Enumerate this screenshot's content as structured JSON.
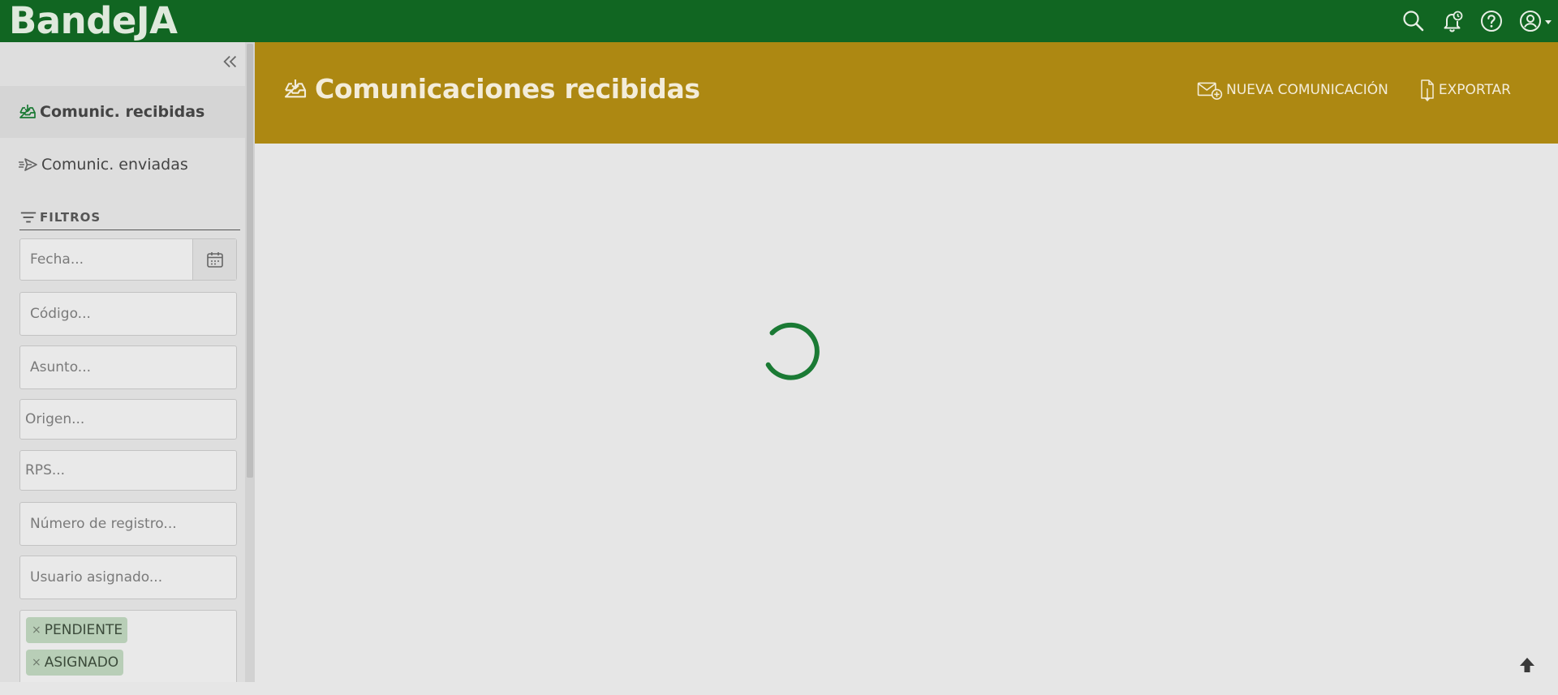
{
  "app": {
    "logo": "BandeJA"
  },
  "topbar": {
    "icons": [
      "search-icon",
      "bell-clock-icon",
      "help-icon",
      "user-circle-icon"
    ]
  },
  "sidebar": {
    "nav": [
      {
        "label": "Comunic. recibidas",
        "icon": "inbox-download-icon",
        "active": true
      },
      {
        "label": "Comunic. enviadas",
        "icon": "send-icon",
        "active": false
      }
    ],
    "filters_title": "FILTROS",
    "fields": {
      "fecha": "Fecha...",
      "codigo": "Código...",
      "asunto": "Asunto...",
      "origen": "Origen...",
      "rps": "RPS...",
      "numero_registro": "Número de registro...",
      "usuario_asignado": "Usuario asignado..."
    },
    "status_tags": [
      "PENDIENTE",
      "ASIGNADO"
    ],
    "tag_remove": "×"
  },
  "header": {
    "title": "Comunicaciones recibidas",
    "actions": {
      "new": "NUEVA COMUNICACIÓN",
      "export": "EXPORTAR"
    }
  },
  "colors": {
    "topbar": "#116622",
    "banner": "#ad8812",
    "spinner": "#1a7a34",
    "tag_bg": "#b8ceb7"
  }
}
